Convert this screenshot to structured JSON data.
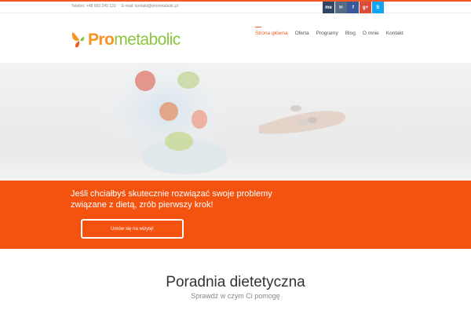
{
  "topbar": {
    "phone": "Telefon: +48 660 245 133",
    "email": "E-mail: kontakt@prometabolic.pl",
    "social": [
      {
        "name": "me",
        "icon": "me-icon",
        "color": "#304564",
        "glyph": "me"
      },
      {
        "name": "email",
        "icon": "email-icon",
        "color": "#536b84",
        "glyph": "✉"
      },
      {
        "name": "facebook",
        "icon": "facebook-icon",
        "color": "#3b5998",
        "glyph": "f"
      },
      {
        "name": "google-plus",
        "icon": "google-plus-icon",
        "color": "#dd4b39",
        "glyph": "g+"
      },
      {
        "name": "skype",
        "icon": "skype-icon",
        "color": "#12a5f4",
        "glyph": "S"
      }
    ]
  },
  "header": {
    "logo": {
      "pro": "Pro",
      "rest": "metabolic"
    },
    "nav": [
      {
        "label": "Strona główna",
        "active": true
      },
      {
        "label": "Oferta",
        "active": false
      },
      {
        "label": "Programy",
        "active": false
      },
      {
        "label": "Blog",
        "active": false
      },
      {
        "label": "O mnie",
        "active": false
      },
      {
        "label": "Kontakt",
        "active": false
      }
    ]
  },
  "cta": {
    "text": "Jeśli chciałbyś skutecznie rozwiązać swoje problemy związane z dietą, zrób pierwszy krok!",
    "button": "Umów się na wizytę!"
  },
  "section": {
    "title": "Poradnia dietetyczna",
    "subtitle": "Sprawdź w czym Ci pomogę"
  },
  "colors": {
    "accent": "#f15a22",
    "cta_bg": "#f3520f",
    "logo_orange": "#f7931e",
    "logo_green": "#8cc63f"
  }
}
